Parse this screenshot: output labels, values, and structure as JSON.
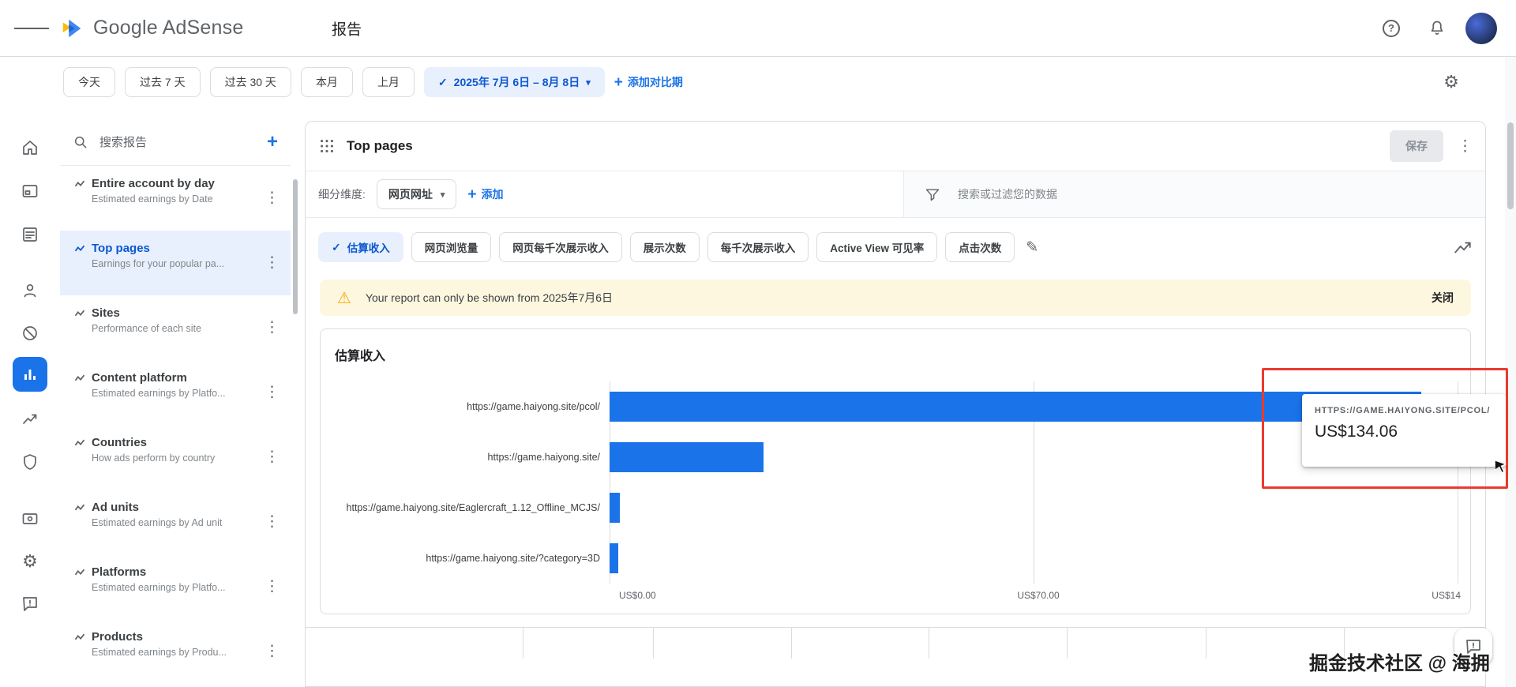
{
  "topbar": {
    "brand": "Google AdSense",
    "page_title": "报告"
  },
  "datebar": {
    "presets": [
      "今天",
      "过去 7 天",
      "过去 30 天",
      "本月",
      "上月"
    ],
    "range_label": "2025年 7月 6日 – 8月 8日",
    "add_comparison_label": "添加对比期"
  },
  "sidebar": {
    "search_placeholder": "搜索报告",
    "items": [
      {
        "title": "Entire account by day",
        "subtitle": "Estimated earnings by Date"
      },
      {
        "title": "Top pages",
        "subtitle": "Earnings for your popular pa..."
      },
      {
        "title": "Sites",
        "subtitle": "Performance of each site"
      },
      {
        "title": "Content platform",
        "subtitle": "Estimated earnings by Platfo..."
      },
      {
        "title": "Countries",
        "subtitle": "How ads perform by country"
      },
      {
        "title": "Ad units",
        "subtitle": "Estimated earnings by Ad unit"
      },
      {
        "title": "Platforms",
        "subtitle": "Estimated earnings by Platfo..."
      },
      {
        "title": "Products",
        "subtitle": "Estimated earnings by Produ..."
      }
    ]
  },
  "panel": {
    "title": "Top pages",
    "save_label": "保存"
  },
  "breakdown": {
    "label": "细分维度:",
    "dimension": "网页网址",
    "add_label": "添加"
  },
  "filterbox": {
    "placeholder": "搜索或过滤您的数据"
  },
  "metrics": {
    "items": [
      "估算收入",
      "网页浏览量",
      "网页每千次展示收入",
      "展示次数",
      "每千次展示收入",
      "Active View 可见率",
      "点击次数"
    ]
  },
  "warning": {
    "text": "Your report can only be shown from 2025年7月6日",
    "close_label": "关闭"
  },
  "chart_data": {
    "type": "bar",
    "orientation": "horizontal",
    "title": "估算收入",
    "categories": [
      "https://game.haiyong.site/pcol/",
      "https://game.haiyong.site/",
      "https://game.haiyong.site/Eaglercraft_1.12_Offline_MCJS/",
      "https://game.haiyong.site/?category=3D"
    ],
    "values": [
      134.06,
      25.4,
      1.7,
      1.5
    ],
    "xlim": [
      0,
      140
    ],
    "x_ticks": [
      "US$0.00",
      "US$70.00",
      "US$14"
    ],
    "grid": true,
    "legend": false,
    "tooltip": {
      "label": "HTTPS://GAME.HAIYONG.SITE/PCOL/",
      "value": "US$134.06"
    }
  },
  "colors": {
    "accent": "#1a73e8",
    "accent_dark": "#0b57d0",
    "selected_bg": "#e8f0fe",
    "warning_bg": "#fef7e0",
    "warning_icon": "#f9ab00",
    "bar_dark": "#185abc",
    "bar_light": "#1a73e8",
    "annotation": "#ea3b2e"
  },
  "watermark": "掘金技术社区 @ 海拥"
}
